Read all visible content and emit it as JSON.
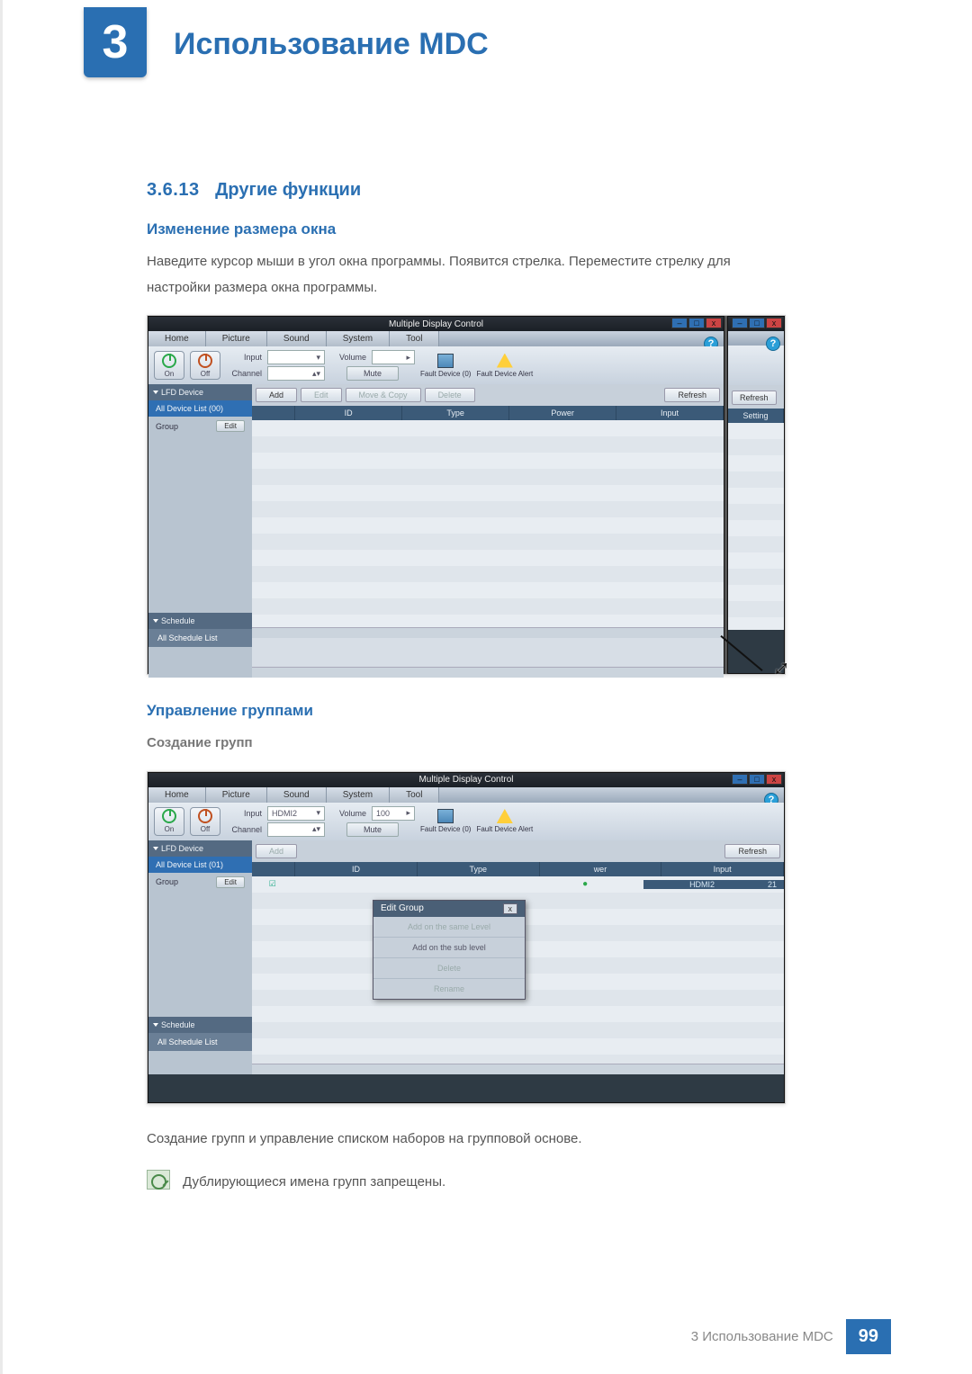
{
  "chapter": {
    "number": "3",
    "title": "Использование MDC"
  },
  "section": {
    "number": "3.6.13",
    "title": "Другие функции"
  },
  "resize": {
    "heading": "Изменение размера окна",
    "para": "Наведите курсор мыши в угол окна программы. Появится стрелка. Переместите стрелку для настройки размера окна программы."
  },
  "groups": {
    "heading": "Управление группами",
    "sub": "Создание групп",
    "caption": "Создание групп и управление списком наборов на групповой основе.",
    "note": "Дублирующиеся имена групп запрещены."
  },
  "app": {
    "title": "Multiple Display Control",
    "help": "?",
    "menus": [
      "Home",
      "Picture",
      "Sound",
      "System",
      "Tool"
    ],
    "power": {
      "on": "On",
      "off": "Off"
    },
    "inputLabel": "Input",
    "channelLabel": "Channel",
    "volumeLabel": "Volume",
    "inputVal2": "HDMI2",
    "volumeVal2": "100",
    "mute": "Mute",
    "fault0": "Fault Device (0)",
    "faultAlert": "Fault Device Alert",
    "actions": {
      "add": "Add",
      "edit": "Edit",
      "movecopy": "Move & Copy",
      "delete": "Delete",
      "refresh": "Refresh"
    },
    "gridcols1": [
      "",
      "ID",
      "Type",
      "Power",
      "Input"
    ],
    "gridcols_side": [
      "Setting"
    ],
    "gridcols2": [
      "",
      "ID",
      "Type",
      "Power",
      "Input"
    ],
    "rowHDMI": "HDMI2",
    "rowID": "21",
    "rowPwrHint": "wer",
    "nav": {
      "lfd": "LFD Device",
      "all0": "All Device List (00)",
      "all1": "All Device List (01)",
      "group": "Group",
      "edit": "Edit",
      "schedule": "Schedule",
      "allsched": "All Schedule List"
    },
    "ctx": {
      "title": "Edit Group",
      "close": "x",
      "addSame": "Add on the same Level",
      "addSub": "Add on the sub level",
      "del": "Delete",
      "ren": "Rename"
    }
  },
  "footer": {
    "label": "3 Использование MDC",
    "page": "99"
  }
}
